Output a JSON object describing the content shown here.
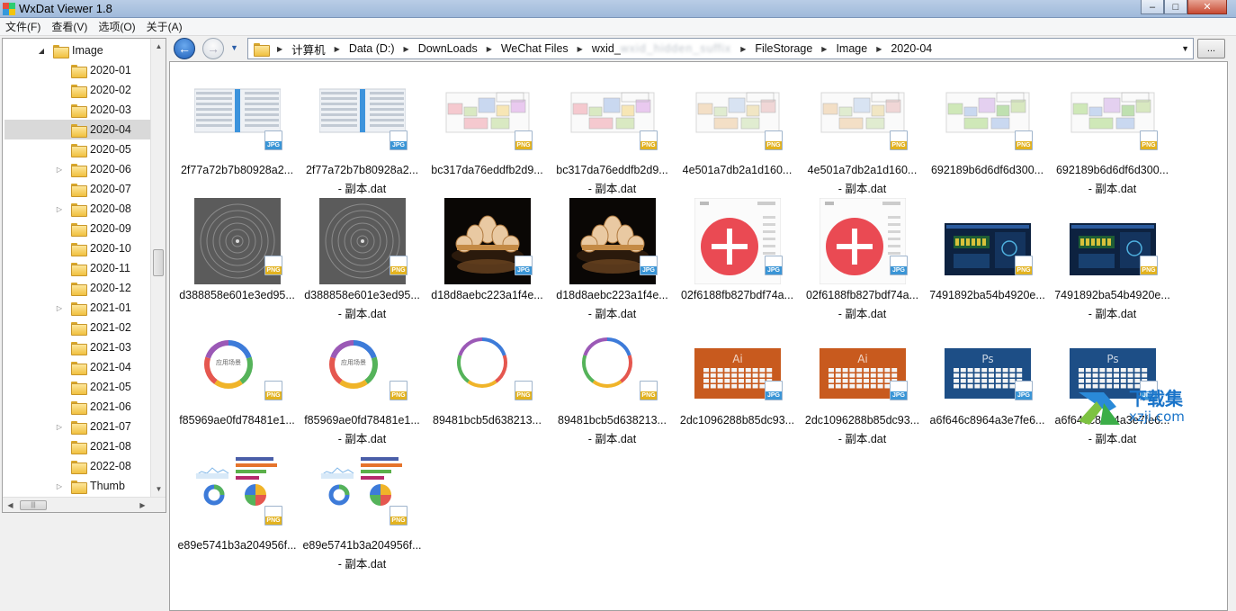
{
  "window": {
    "title": "WxDat Viewer 1.8",
    "min_label": "–",
    "max_label": "□",
    "close_label": "✕"
  },
  "menu": [
    "文件(F)",
    "查看(V)",
    "选项(O)",
    "关于(A)"
  ],
  "tree": {
    "root": "Image",
    "items": [
      "2020-01",
      "2020-02",
      "2020-03",
      "2020-04",
      "2020-05",
      "2020-06",
      "2020-07",
      "2020-08",
      "2020-09",
      "2020-10",
      "2020-11",
      "2020-12",
      "2021-01",
      "2021-02",
      "2021-03",
      "2021-04",
      "2021-05",
      "2021-06",
      "2021-07",
      "2021-08",
      "2022-08",
      "Thumb"
    ],
    "expandable": [
      "2020-06",
      "2020-08",
      "2021-01",
      "2021-07",
      "Thumb"
    ],
    "selected": "2020-04"
  },
  "address": {
    "crumbs": [
      "计算机",
      "Data (D:)",
      "DownLoads",
      "WeChat Files",
      "wxid_",
      "wxid_hidden_suffix",
      "FileStorage",
      "Image",
      "2020-04"
    ],
    "more_label": "..."
  },
  "files": [
    {
      "name": "2f77a72b7b80928a2...",
      "sub": "",
      "type": "JPG",
      "thumb": "spreadsheet"
    },
    {
      "name": "2f77a72b7b80928a2...",
      "sub": "- 副本.dat",
      "type": "JPG",
      "thumb": "spreadsheet"
    },
    {
      "name": "bc317da76eddfb2d9...",
      "sub": "",
      "type": "PNG",
      "thumb": "floorplan-red"
    },
    {
      "name": "bc317da76eddfb2d9...",
      "sub": "- 副本.dat",
      "type": "PNG",
      "thumb": "floorplan-red"
    },
    {
      "name": "4e501a7db2a1d160...",
      "sub": "",
      "type": "PNG",
      "thumb": "floorplan-light"
    },
    {
      "name": "4e501a7db2a1d160...",
      "sub": "- 副本.dat",
      "type": "PNG",
      "thumb": "floorplan-light"
    },
    {
      "name": "692189b6d6df6d300...",
      "sub": "",
      "type": "PNG",
      "thumb": "floorplan-green"
    },
    {
      "name": "692189b6d6df6d300...",
      "sub": "- 副本.dat",
      "type": "PNG",
      "thumb": "floorplan-green"
    },
    {
      "name": "d388858e601e3ed95...",
      "sub": "",
      "type": "PNG",
      "thumb": "rings"
    },
    {
      "name": "d388858e601e3ed95...",
      "sub": "- 副本.dat",
      "type": "PNG",
      "thumb": "rings"
    },
    {
      "name": "d18d8aebc223a1f4e...",
      "sub": "",
      "type": "JPG",
      "thumb": "lotus"
    },
    {
      "name": "d18d8aebc223a1f4e...",
      "sub": "- 副本.dat",
      "type": "JPG",
      "thumb": "lotus"
    },
    {
      "name": "02f6188fb827bdf74a...",
      "sub": "",
      "type": "JPG",
      "thumb": "plus"
    },
    {
      "name": "02f6188fb827bdf74a...",
      "sub": "- 副本.dat",
      "type": "JPG",
      "thumb": "plus"
    },
    {
      "name": "7491892ba54b4920e...",
      "sub": "",
      "type": "PNG",
      "thumb": "dashboard"
    },
    {
      "name": "7491892ba54b4920e...",
      "sub": "- 副本.dat",
      "type": "PNG",
      "thumb": "dashboard"
    },
    {
      "name": "f85969ae0fd78481e1...",
      "sub": "",
      "type": "PNG",
      "thumb": "donut-label"
    },
    {
      "name": "f85969ae0fd78481e1...",
      "sub": "- 副本.dat",
      "type": "PNG",
      "thumb": "donut-label"
    },
    {
      "name": "89481bcb5d638213...",
      "sub": "",
      "type": "PNG",
      "thumb": "ring"
    },
    {
      "name": "89481bcb5d638213...",
      "sub": "- 副本.dat",
      "type": "PNG",
      "thumb": "ring"
    },
    {
      "name": "2dc1096288b85dc93...",
      "sub": "",
      "type": "JPG",
      "thumb": "keyboard-ai"
    },
    {
      "name": "2dc1096288b85dc93...",
      "sub": "- 副本.dat",
      "type": "JPG",
      "thumb": "keyboard-ai"
    },
    {
      "name": "a6f646c8964a3e7fe6...",
      "sub": "",
      "type": "JPG",
      "thumb": "keyboard-ps"
    },
    {
      "name": "a6f646c8964a3e7fe6...",
      "sub": "- 副本.dat",
      "type": "JPG",
      "thumb": "keyboard-ps"
    },
    {
      "name": "e89e5741b3a204956f...",
      "sub": "",
      "type": "PNG",
      "thumb": "charts"
    },
    {
      "name": "e89e5741b3a204956f...",
      "sub": "- 副本.dat",
      "type": "PNG",
      "thumb": "charts"
    }
  ],
  "thumb_text": {
    "donut_label": "应用场景",
    "ai": "Ai",
    "ps": "Ps"
  },
  "watermark": {
    "title": "下载集",
    "url": "xzji.com"
  },
  "colors": {
    "accent_blue": "#1f5fb8",
    "selected_row": "#d9d9d9",
    "jpg_badge": "#3a95d6",
    "png_badge": "#e2b21f"
  }
}
